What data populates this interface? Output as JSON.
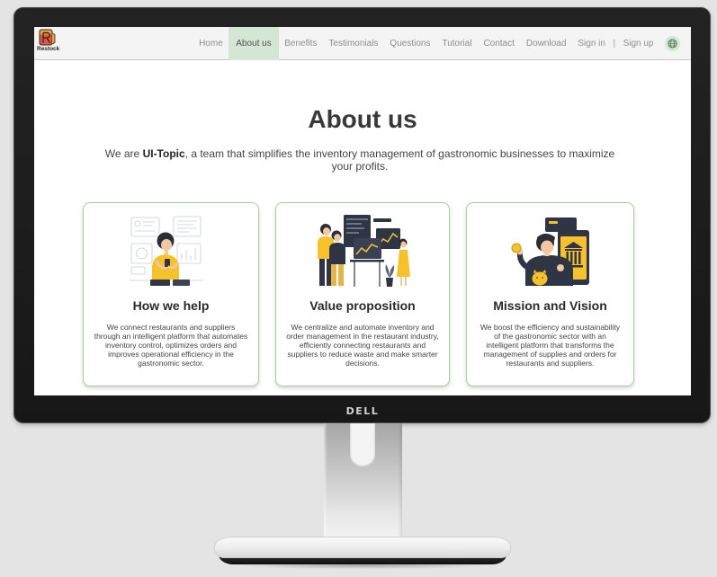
{
  "monitor": {
    "brand": "DELL"
  },
  "site": {
    "logo_text": "Restock",
    "nav": {
      "items": [
        {
          "label": "Home",
          "active": false
        },
        {
          "label": "About us",
          "active": true
        },
        {
          "label": "Benefits",
          "active": false
        },
        {
          "label": "Testimonials",
          "active": false
        },
        {
          "label": "Questions",
          "active": false
        },
        {
          "label": "Tutorial",
          "active": false
        },
        {
          "label": "Contact",
          "active": false
        },
        {
          "label": "Download",
          "active": false
        }
      ],
      "sign_in": "Sign in",
      "separator": "|",
      "sign_up": "Sign up",
      "language_icon": "globe-icon"
    },
    "about": {
      "title": "About us",
      "intro_prefix": "We are ",
      "intro_brand": "UI-Topic",
      "intro_suffix": ", a team that simplifies the inventory management of gastronomic businesses to maximize your profits."
    },
    "cards": [
      {
        "illustration": "woman-with-phone-illustration",
        "title": "How we help",
        "text": "We connect restaurants and suppliers through an intelligent platform that automates inventory control, optimizes orders and improves operational efficiency in the gastronomic sector."
      },
      {
        "illustration": "team-with-dashboards-illustration",
        "title": "Value proposition",
        "text": "We centralize and automate inventory and order management in the restaurant industry, efficiently connecting restaurants and suppliers to reduce waste and make smarter decisions."
      },
      {
        "illustration": "man-with-coin-and-bank-phone-illustration",
        "title": "Mission and Vision",
        "text": "We boost the efficiency and sustainability of the gastronomic sector with an intelligent platform that transforms the management of supplies and orders for restaurants and suppliers."
      }
    ]
  },
  "colors": {
    "active_nav_bg": "#d4e7d4",
    "card_border": "#a9cba9",
    "illustration_yellow": "#f6c12b",
    "illustration_navy": "#2f3545",
    "logo_red": "#e8563f",
    "logo_orange": "#f2a13b"
  }
}
